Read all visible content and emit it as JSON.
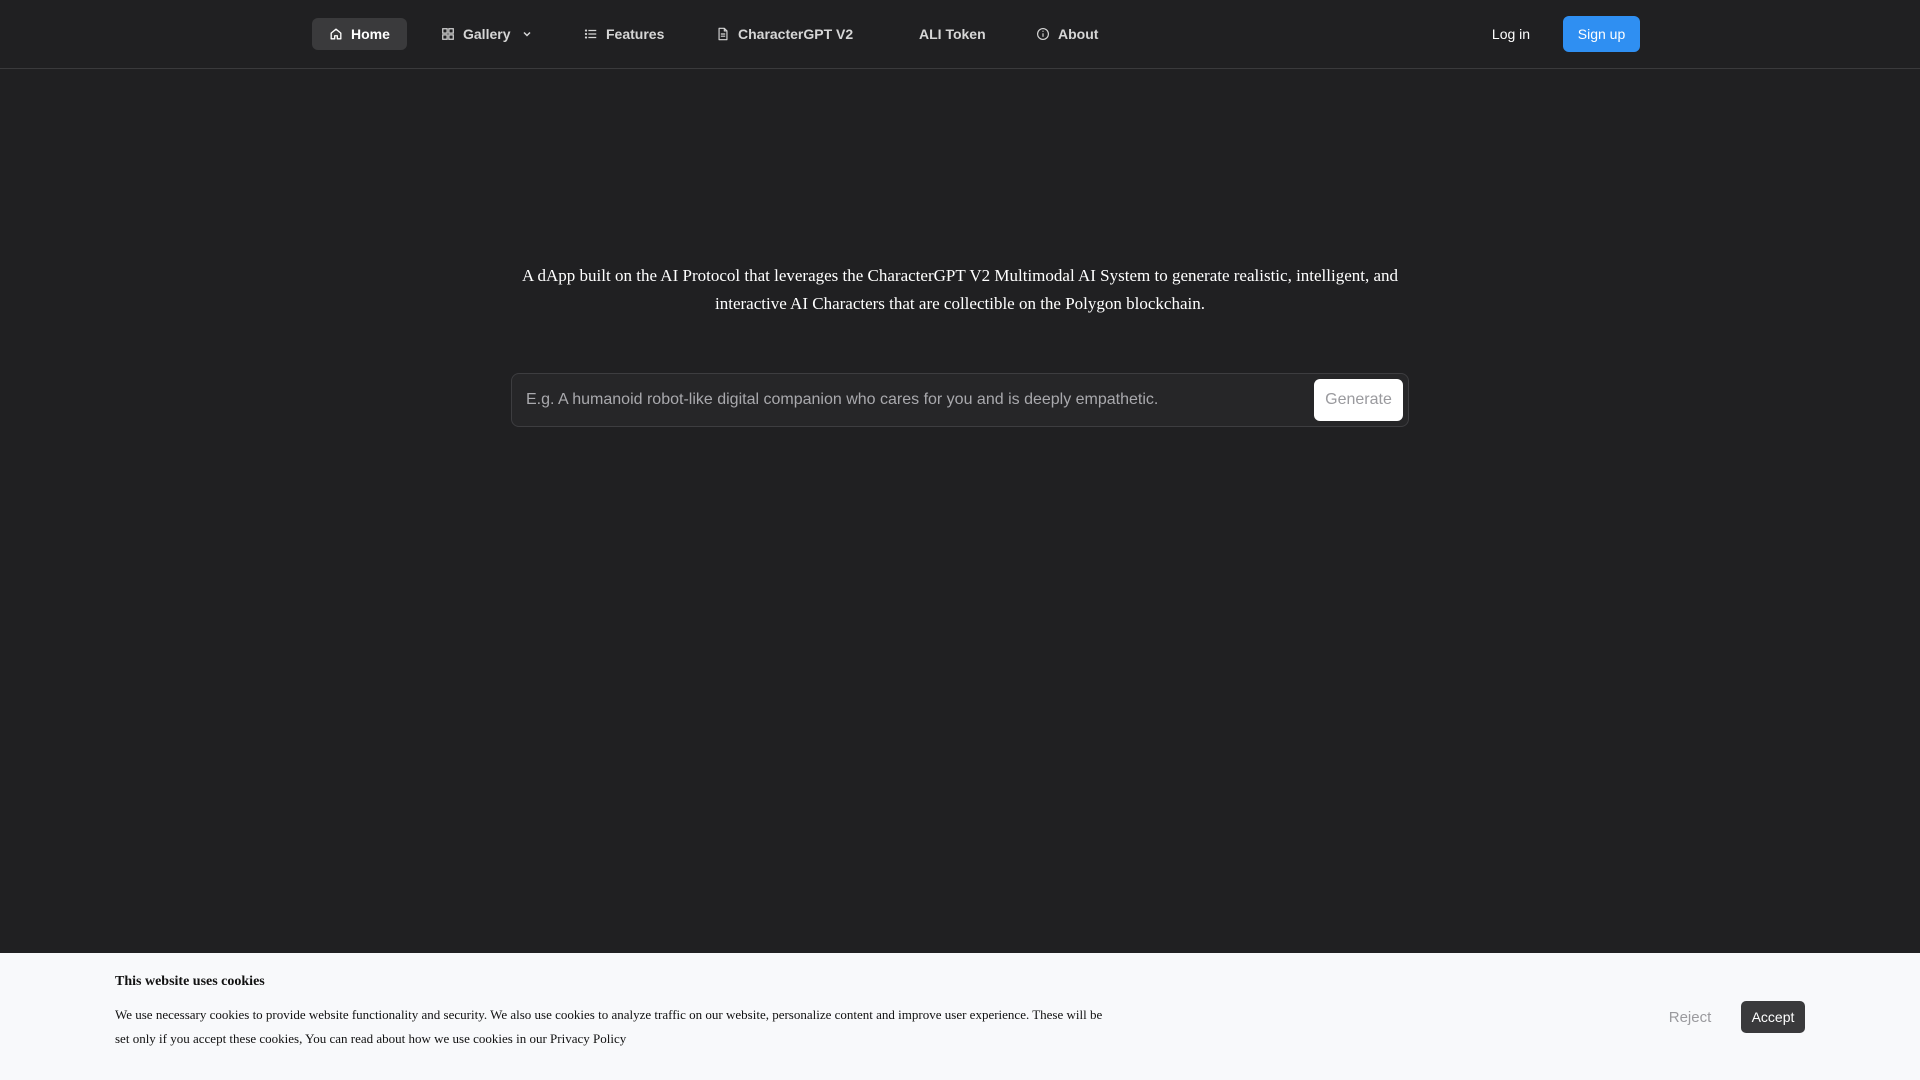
{
  "nav": {
    "items": [
      {
        "label": "Home",
        "icon": "home-icon",
        "active": true
      },
      {
        "label": "Gallery",
        "icon": "grid-icon",
        "has_dropdown": true
      },
      {
        "label": "Features",
        "icon": "list-icon"
      },
      {
        "label": "CharacterGPT V2",
        "icon": "document-icon"
      },
      {
        "label": "ALI Token",
        "icon": ""
      },
      {
        "label": "About",
        "icon": "info-icon"
      }
    ],
    "login_label": "Log in",
    "signup_label": "Sign up"
  },
  "hero": {
    "tagline": "A dApp built on the AI Protocol that leverages the CharacterGPT V2 Multimodal AI System to generate realistic, intelligent, and interactive AI Characters that are collectible on the Polygon blockchain.",
    "prompt_placeholder": "E.g. A humanoid robot-like digital companion who cares for you and is deeply empathetic.",
    "prompt_value": "",
    "generate_label": "Generate"
  },
  "cookie_banner": {
    "title": "This website uses cookies",
    "text": "We use necessary cookies to provide website functionality and security. We also use cookies to analyze traffic on our website, personalize content and improve user experience. These will be set only if you accept these cookies, You can read about how we use cookies in our Privacy Policy",
    "reject_label": "Reject",
    "accept_label": "Accept"
  },
  "colors": {
    "background": "#202022",
    "accent": "#2f8ff2",
    "banner_bg": "#f8f9fb"
  }
}
